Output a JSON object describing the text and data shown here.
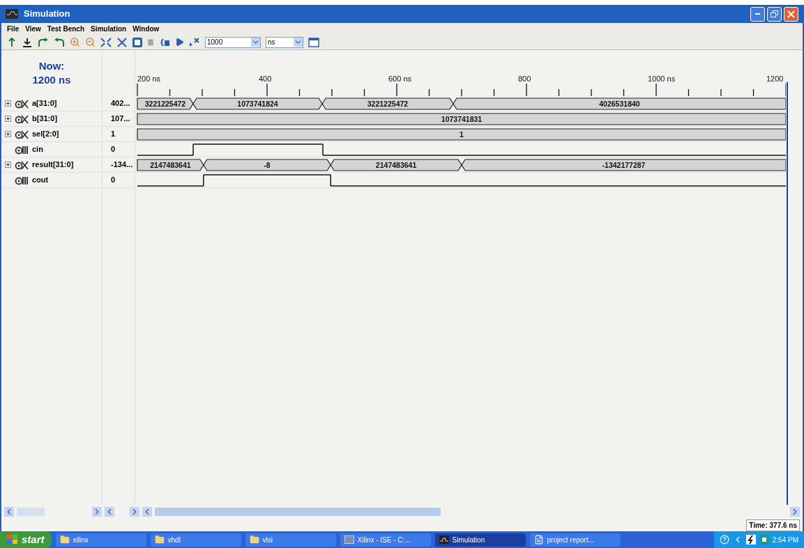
{
  "window": {
    "title": "Simulation"
  },
  "menu": [
    "File",
    "View",
    "Test Bench",
    "Simulation",
    "Window"
  ],
  "toolbar": {
    "run_time": "1000",
    "unit": "ns"
  },
  "now": {
    "label": "Now:",
    "time": "1200 ns"
  },
  "timeline": [
    "200 ns",
    "400",
    "600 ns",
    "800",
    "1000 ns",
    "1200"
  ],
  "signals": [
    {
      "kind": "bus",
      "name": "a[31:0]",
      "value": "402...",
      "expanded": false,
      "segments": [
        {
          "text": "3221225472"
        },
        {
          "text": "1073741824"
        },
        {
          "text": "3221225472"
        },
        {
          "text": "4026531840"
        }
      ]
    },
    {
      "kind": "bus",
      "name": "b[31:0]",
      "value": "107...",
      "expanded": false,
      "segments": [
        {
          "text": "1073741831"
        }
      ]
    },
    {
      "kind": "bus",
      "name": "sel[2:0]",
      "value": "1",
      "expanded": false,
      "segments": [
        {
          "text": "1"
        }
      ]
    },
    {
      "kind": "bit",
      "name": "cin",
      "value": "0",
      "segments": [
        {
          "high": false
        },
        {
          "high": true
        },
        {
          "high": false
        }
      ]
    },
    {
      "kind": "bus",
      "name": "result[31:0]",
      "value": "-134...",
      "expanded": false,
      "segments": [
        {
          "text": "2147483641"
        },
        {
          "text": "-8"
        },
        {
          "text": "2147483641"
        },
        {
          "text": "-1342177287"
        }
      ]
    },
    {
      "kind": "bit",
      "name": "cout",
      "value": "0",
      "segments": [
        {
          "high": false
        },
        {
          "high": true
        },
        {
          "high": false
        }
      ]
    }
  ],
  "status": {
    "time": "Time: 377.6 ns"
  },
  "taskbar": {
    "start": "start",
    "items": [
      {
        "label": "xilinx",
        "kind": "folder",
        "selected": false
      },
      {
        "label": "vhdl",
        "kind": "folder",
        "selected": false
      },
      {
        "label": "vlsi",
        "kind": "folder",
        "selected": false
      },
      {
        "label": "Xilinx - ISE - C:...",
        "kind": "app",
        "selected": false
      },
      {
        "label": "Simulation",
        "kind": "wave",
        "selected": true
      },
      {
        "label": "project report...",
        "kind": "doc",
        "selected": false
      }
    ],
    "clock": "2:54 PM"
  }
}
